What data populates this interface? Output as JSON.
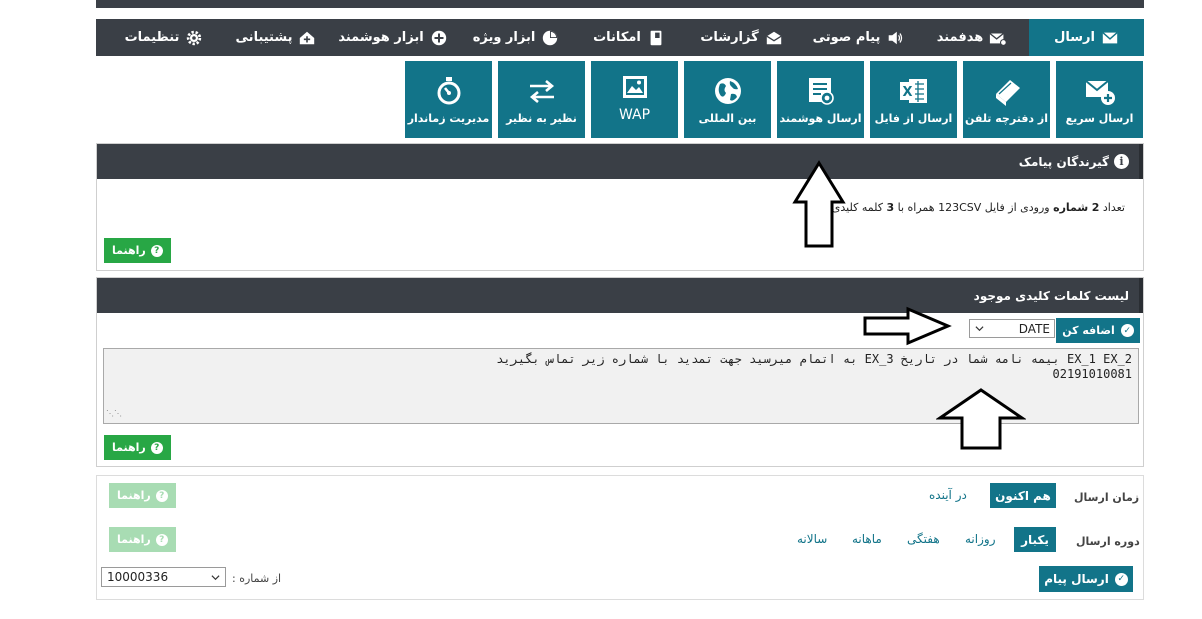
{
  "nav": [
    {
      "label": "ارسال",
      "icon": "envelope-icon",
      "active": true
    },
    {
      "label": "هدفمند",
      "icon": "envelope-target-icon"
    },
    {
      "label": "پیام صوتی",
      "icon": "speaker-icon"
    },
    {
      "label": "گزارشات",
      "icon": "open-envelope-icon"
    },
    {
      "label": "امکانات",
      "icon": "book-icon"
    },
    {
      "label": "ابزار ویژه",
      "icon": "pie-chart-icon"
    },
    {
      "label": "ابزار هوشمند",
      "icon": "plus-circle-icon"
    },
    {
      "label": "پشتیبانی",
      "icon": "home-plus-icon"
    },
    {
      "label": "تنظیمات",
      "icon": "gear-icon"
    }
  ],
  "tiles": [
    {
      "label": "ارسال سریع",
      "icon": "envelope-plus-icon"
    },
    {
      "label": "از دفترچه تلفن",
      "icon": "notebook-icon"
    },
    {
      "label": "ارسال از فایل",
      "icon": "excel-file-icon"
    },
    {
      "label": "ارسال هوشمند",
      "icon": "smart-list-icon"
    },
    {
      "label": "بین المللی",
      "icon": "globe-icon"
    },
    {
      "label": "WAP",
      "icon": "image-frame-icon"
    },
    {
      "label": "نظیر به نظیر",
      "icon": "swap-arrows-icon"
    },
    {
      "label": "مدیریت زماندار",
      "icon": "stopwatch-icon"
    }
  ],
  "recipients": {
    "title": "گیرندگان پیامک",
    "summary": {
      "p1": "تعداد",
      "count": "2",
      "unit": "شماره",
      "p2": "ورودی از فایل 123CSV همراه با",
      "keywords": "3",
      "p3": "کلمه کلیدی"
    },
    "help": "راهنما"
  },
  "keywords": {
    "title": "لیست کلمات کلیدی موجود",
    "add_button": "اضافه کن",
    "selected": "DATE",
    "message_line1": "EX_1  EX_2 بیمه نامه شما در تاریخ  EX_3 به اتمام میرسید جهت تمدید با شماره زیر تماس بگیرید",
    "message_line2": "02191010081",
    "help": "راهنما"
  },
  "send": {
    "time_label": "زمان ارسال",
    "time_options": [
      "هم اکنون",
      "در آینده"
    ],
    "period_label": "دوره ارسال",
    "period_options": [
      "یکبار",
      "روزانه",
      "هفتگی",
      "ماهانه",
      "سالانه"
    ],
    "help1": "راهنما",
    "help2": "راهنما",
    "from_label": "از شماره :",
    "from_number": "10000336",
    "submit": "ارسال پیام"
  },
  "colors": {
    "teal": "#127489",
    "dark": "#3a3f46",
    "green": "#28a745"
  }
}
